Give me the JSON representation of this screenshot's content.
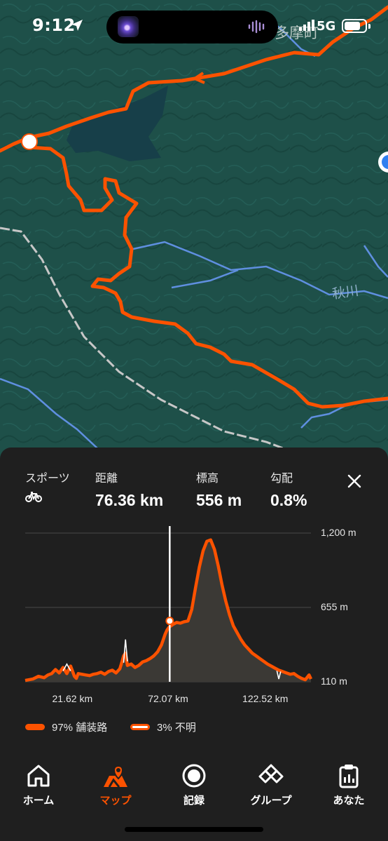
{
  "status_bar": {
    "time": "9:12",
    "network": "5G",
    "battery_level": 0.78,
    "icons": [
      "location-arrow-icon",
      "signal-bars-icon",
      "battery-icon"
    ]
  },
  "map": {
    "place_label": "多摩町",
    "river_label": "秋川",
    "colors": {
      "terrain": "#1e5049",
      "route": "#fc5200",
      "water": "#7aa5ff",
      "road": "#c7c7c7"
    }
  },
  "stats": {
    "sport_label": "スポーツ",
    "sport_icon": "bike-icon",
    "distance_label": "距離",
    "distance_value": "76.36 km",
    "elevation_label": "標高",
    "elevation_value": "556 m",
    "grade_label": "勾配",
    "grade_value": "0.8%"
  },
  "chart_data": {
    "type": "area",
    "title": "",
    "xlabel": "",
    "ylabel": "",
    "y_tick_labels": [
      "1,200 m",
      "655 m",
      "110 m"
    ],
    "x_tick_labels": [
      "21.62 km",
      "72.07 km",
      "122.52 km"
    ],
    "ylim": [
      110,
      1200
    ],
    "xlim": [
      0,
      151
    ],
    "selected_x": 76.36,
    "selected_y": 556,
    "series": [
      {
        "name": "97% 舗装路",
        "x": [
          0,
          4,
          7,
          10,
          12,
          14,
          16,
          18,
          20,
          22,
          24,
          26,
          27,
          28,
          30,
          32,
          34,
          36,
          38,
          40,
          42,
          44,
          46,
          48,
          50,
          51,
          52,
          53,
          54,
          56,
          58,
          60,
          62,
          64,
          66,
          68,
          70,
          72,
          73,
          74,
          75,
          76,
          78,
          80,
          82,
          84,
          86,
          88,
          90,
          92,
          94,
          96,
          98,
          100,
          102,
          104,
          106,
          108,
          110,
          112,
          114,
          116,
          118,
          120,
          122,
          124,
          126,
          128,
          130,
          132,
          134,
          136,
          138,
          140,
          142,
          144,
          146,
          148,
          150,
          151
        ],
        "values": [
          120,
          130,
          150,
          140,
          160,
          170,
          200,
          175,
          215,
          170,
          225,
          150,
          135,
          170,
          165,
          160,
          155,
          165,
          170,
          180,
          165,
          185,
          195,
          175,
          205,
          250,
          300,
          320,
          230,
          240,
          215,
          230,
          255,
          265,
          280,
          300,
          330,
          380,
          420,
          460,
          490,
          510,
          530,
          545,
          540,
          550,
          556,
          640,
          800,
          950,
          1070,
          1140,
          1150,
          1080,
          960,
          820,
          700,
          600,
          520,
          470,
          420,
          380,
          350,
          320,
          300,
          280,
          260,
          240,
          225,
          210,
          195,
          185,
          175,
          165,
          170,
          150,
          135,
          125,
          160,
          130
        ]
      },
      {
        "name": "3% 不明",
        "x": [
          20,
          22,
          24,
          52,
          53,
          54,
          133,
          134,
          135
        ],
        "values": [
          190,
          240,
          190,
          250,
          420,
          260,
          190,
          130,
          185
        ]
      }
    ],
    "legend_placement": "bottom-left",
    "grid": true
  },
  "legend": {
    "paved": "97% 舗装路",
    "unknown": "3% 不明"
  },
  "tabs": [
    {
      "label": "ホーム",
      "icon": "home-icon"
    },
    {
      "label": "マップ",
      "icon": "map-icon"
    },
    {
      "label": "記録",
      "icon": "record-icon"
    },
    {
      "label": "グループ",
      "icon": "groups-icon"
    },
    {
      "label": "あなた",
      "icon": "profile-icon"
    }
  ],
  "active_tab": "マップ"
}
